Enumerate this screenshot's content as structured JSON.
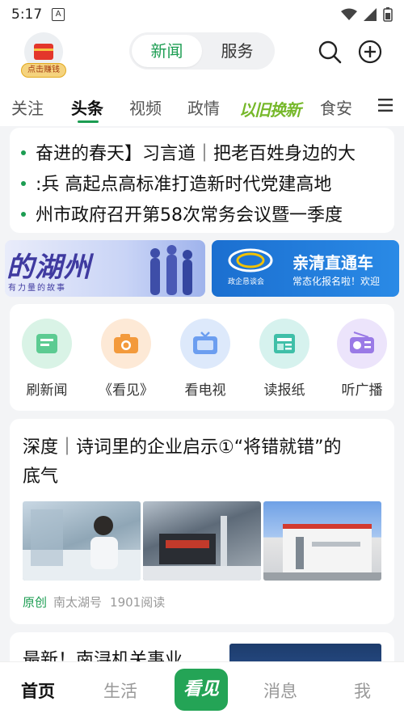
{
  "status_bar": {
    "time": "5:17",
    "notification_icon": "A"
  },
  "header": {
    "avatar_badge": "点击赚钱",
    "segments": [
      "新闻",
      "服务"
    ],
    "active_segment": 0
  },
  "tabs": {
    "items": [
      "关注",
      "头条",
      "视频",
      "政情",
      "以旧换新",
      "食安"
    ],
    "active": "头条"
  },
  "headlines": [
    "奋进的春天】习言道｜把老百姓身边的大",
    ":兵  高起点高标准打造新时代党建高地",
    "州市政府召开第58次常务会议暨一季度"
  ],
  "banners": {
    "left": {
      "title": "的湖州",
      "subtitle": "有力量的故事"
    },
    "right": {
      "tag": "政企恳谈会",
      "title": "亲清直通车",
      "subtitle": "常态化报名啦！欢迎"
    }
  },
  "quick_entries": [
    {
      "label": "刷新闻",
      "icon": "news-refresh-icon",
      "color": "#d9f3e6"
    },
    {
      "label": "《看见》",
      "icon": "camera-icon",
      "color": "#fde9d6"
    },
    {
      "label": "看电视",
      "icon": "tv-icon",
      "color": "#dde9fb"
    },
    {
      "label": "读报纸",
      "icon": "newspaper-icon",
      "color": "#d6f2ee"
    },
    {
      "label": "听广播",
      "icon": "radio-icon",
      "color": "#ece4fb"
    }
  ],
  "article": {
    "title": "深度｜诗词里的企业启示①“将错就错”的底气",
    "original_tag": "原创",
    "source": "南太湖号",
    "views": "1901阅读"
  },
  "next_article": {
    "title": "最新！南浔机关事业"
  },
  "bottom_nav": {
    "items": [
      "首页",
      "生活",
      "看见",
      "消息",
      "我"
    ],
    "active": "首页"
  }
}
